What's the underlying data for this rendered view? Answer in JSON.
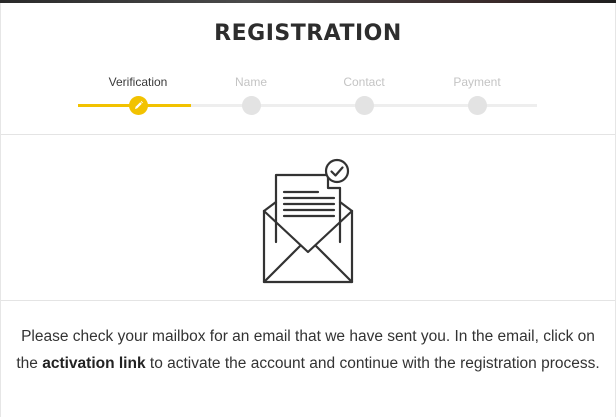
{
  "registration": {
    "title": "REGISTRATION",
    "steps": [
      {
        "label": "Verification",
        "state": "active",
        "icon": "pencil-icon"
      },
      {
        "label": "Name",
        "state": "pending"
      },
      {
        "label": "Contact",
        "state": "pending"
      },
      {
        "label": "Payment",
        "state": "pending"
      }
    ],
    "illustration": {
      "icon": "envelope-letter-check-icon"
    },
    "message": {
      "part1": "Please check your mailbox for an email that we have sent you. In the email, click on the ",
      "link_text": "activation link",
      "part2": " to activate the account and continue with the registration process."
    }
  },
  "colors": {
    "accent": "#f2c200",
    "inactive": "#e3e3e3",
    "text": "#333333"
  }
}
